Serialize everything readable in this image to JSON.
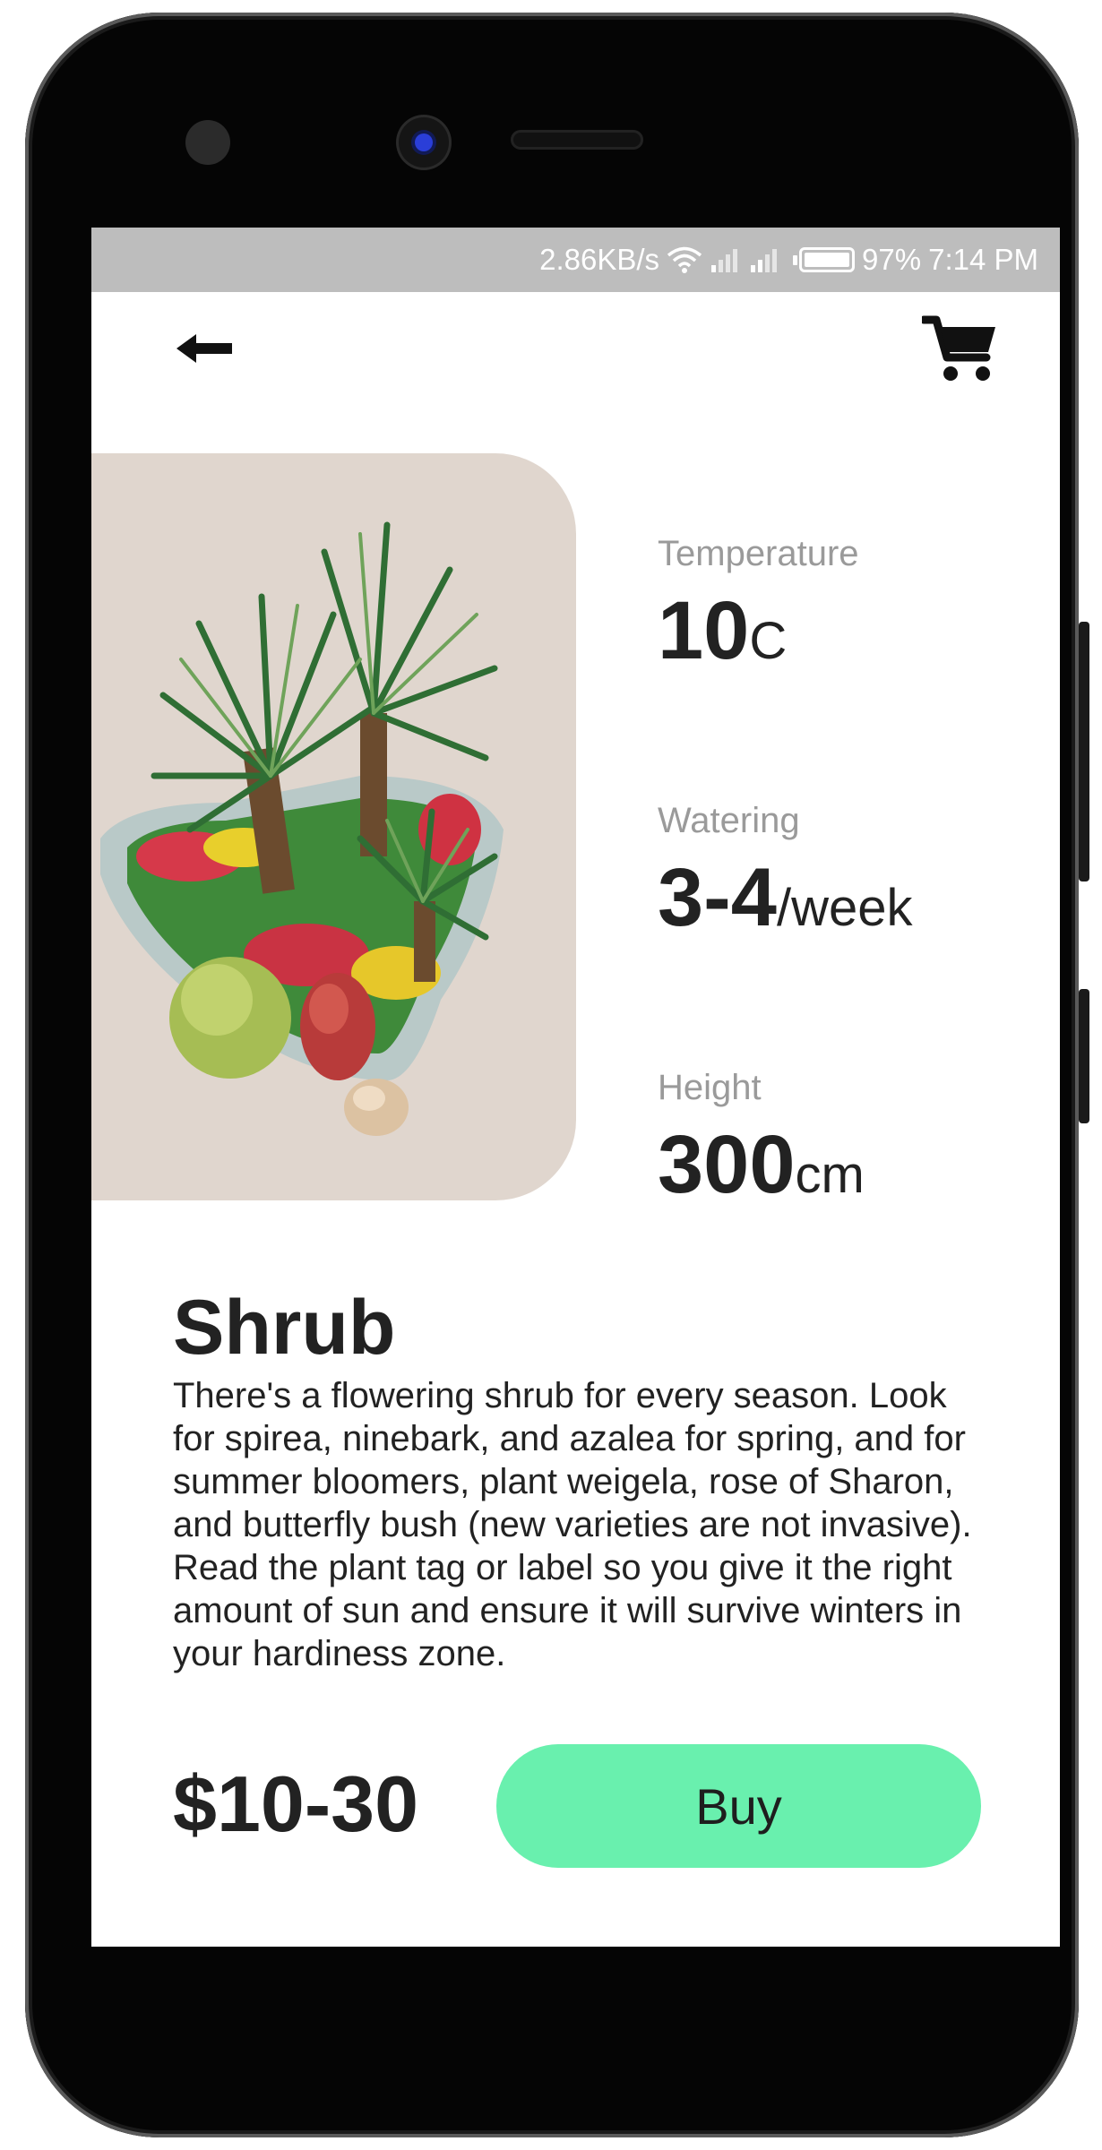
{
  "status_bar": {
    "speed": "2.86KB/s",
    "battery": "97%",
    "time": "7:14 PM"
  },
  "header": {
    "back_icon": "arrow-left-icon",
    "cart_icon": "shopping-cart-icon"
  },
  "stats": [
    {
      "label": "Temperature",
      "value": "10",
      "unit": "C"
    },
    {
      "label": "Watering",
      "value": "3-4",
      "unit": "/week"
    },
    {
      "label": "Height",
      "value": "300",
      "unit": "cm"
    }
  ],
  "product": {
    "name": "Shrub",
    "description": "There's a flowering shrub for every season. Look for spirea, ninebark, and azalea for spring, and for summer bloomers, plant weigela, rose of Sharon, and butterfly bush (new varieties are not invasive). Read the plant tag or label so you give it the right amount of sun and ensure it will survive winters in your hardiness zone.",
    "price": "$10-30",
    "buy_label": "Buy"
  },
  "colors": {
    "accent": "#69f0ae",
    "card_background": "#e0d6ce",
    "status_bar": "#bdbdbd",
    "label_gray": "#9a9a9a",
    "text_dark": "#222222"
  }
}
